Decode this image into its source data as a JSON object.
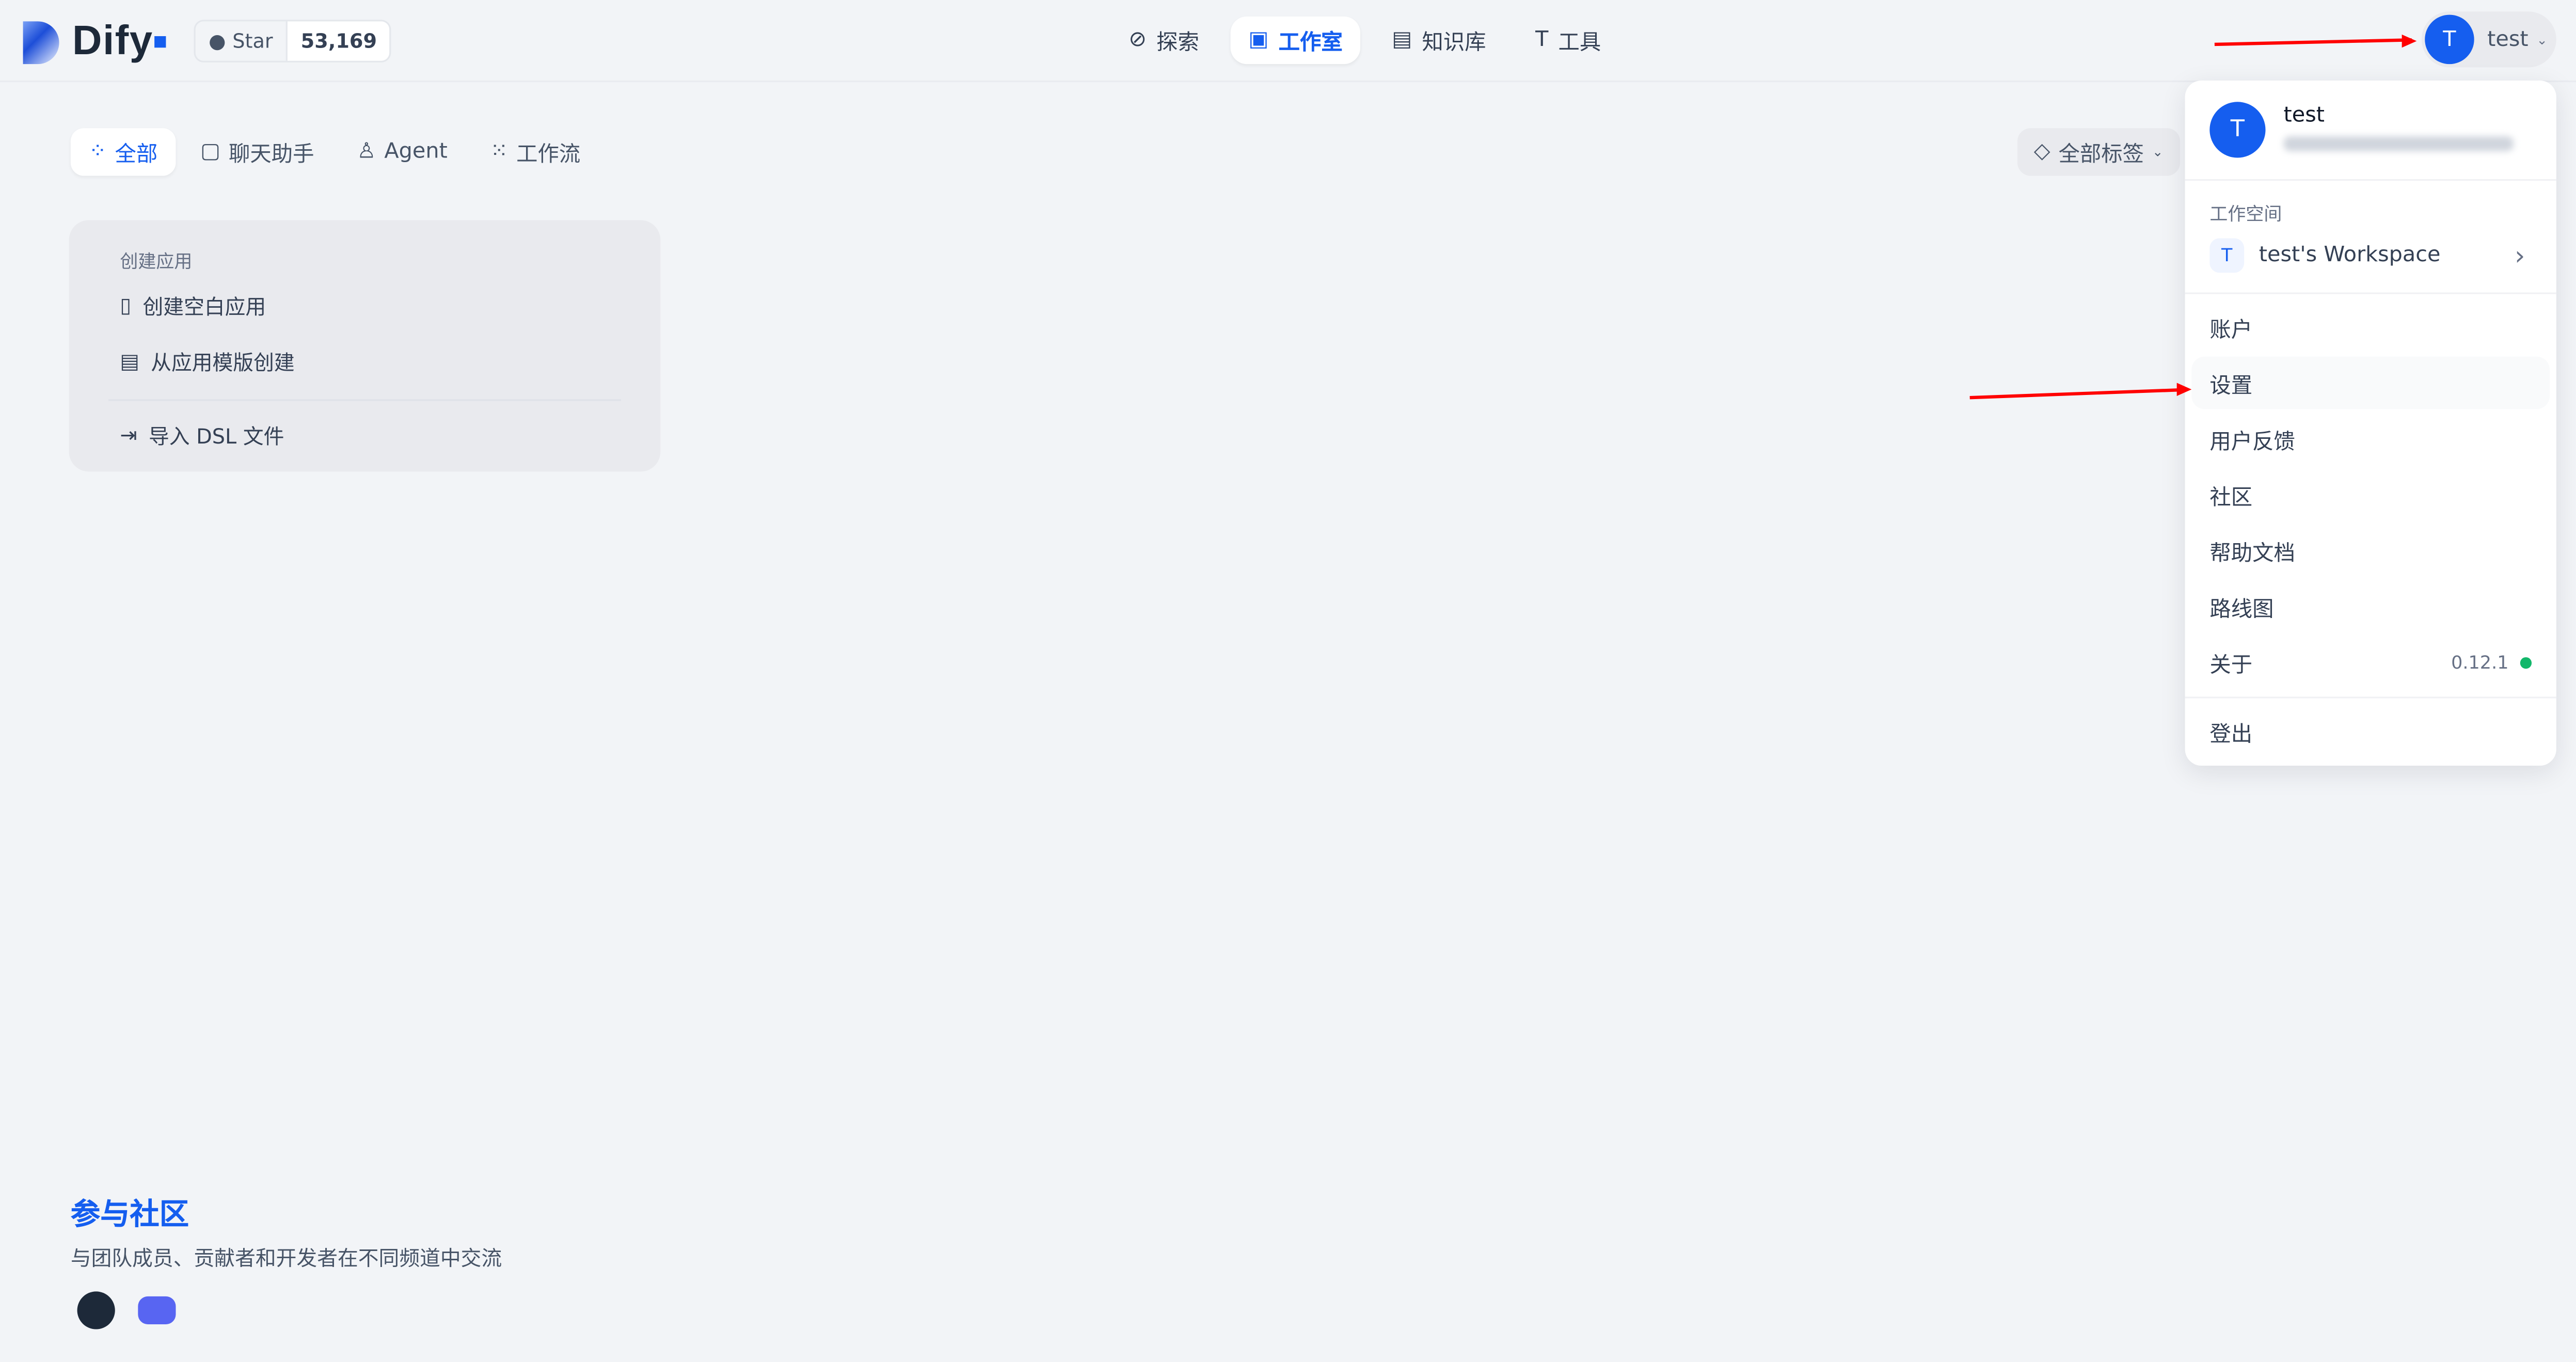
{
  "app": {
    "name": "Dify",
    "github": {
      "star_label": "Star",
      "star_count": "53,169"
    }
  },
  "nav": [
    {
      "label": "探索",
      "icon": "compass-icon"
    },
    {
      "label": "工作室",
      "icon": "robot-icon",
      "active": true
    },
    {
      "label": "知识库",
      "icon": "book-icon"
    },
    {
      "label": "工具",
      "icon": "tool-icon"
    }
  ],
  "user": {
    "initial": "T",
    "name": "test"
  },
  "filters": {
    "tabs": [
      {
        "label": "全部",
        "active": true
      },
      {
        "label": "聊天助手"
      },
      {
        "label": "Agent"
      },
      {
        "label": "工作流"
      }
    ],
    "tag_select": "全部标签"
  },
  "create_card": {
    "title": "创建应用",
    "items": [
      "创建空白应用",
      "从应用模版创建",
      "导入 DSL 文件"
    ]
  },
  "community": {
    "title": "参与社区",
    "subtitle": "与团队成员、贡献者和开发者在不同频道中交流"
  },
  "menu": {
    "user_name": "test",
    "workspace_label": "工作空间",
    "workspace_initial": "T",
    "workspace_name": "test's Workspace",
    "items": [
      "账户",
      "设置",
      "用户反馈",
      "社区",
      "帮助文档",
      "路线图"
    ],
    "about": "关于",
    "version": "0.12.1",
    "logout": "登出"
  },
  "colors": {
    "accent": "#155eef",
    "status": "#12b76a",
    "annotation": "#ff0000"
  }
}
